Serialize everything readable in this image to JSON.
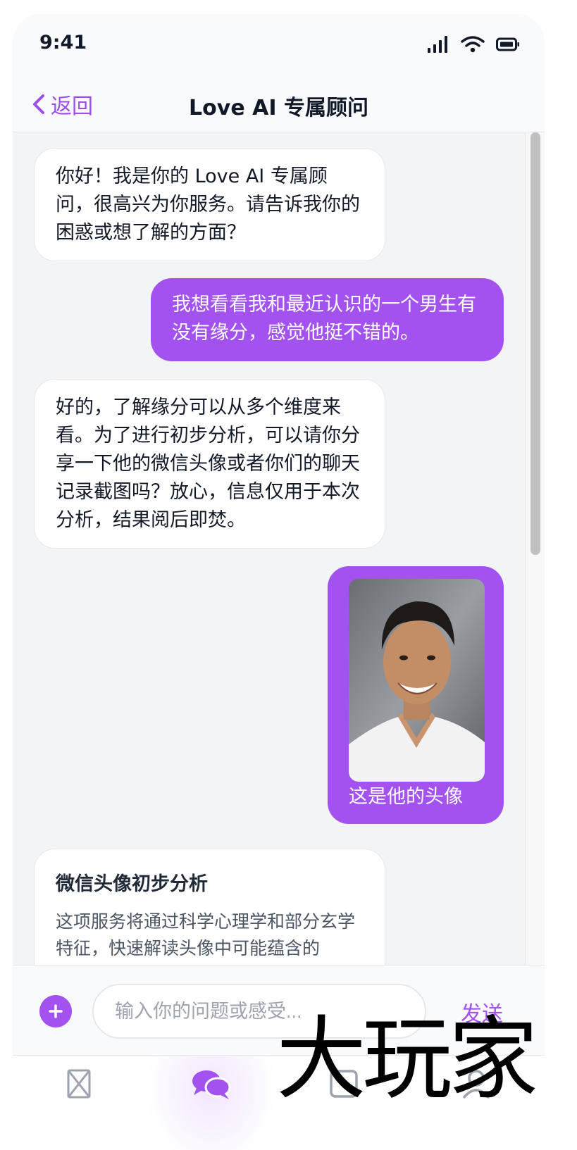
{
  "status_bar": {
    "time": "9:41"
  },
  "header": {
    "back_label": "返回",
    "title": "Love AI 专属顾问"
  },
  "messages": [
    {
      "role": "assistant",
      "text": "你好！我是你的 Love AI 专属顾问，很高兴为你服务。请告诉我你的困惑或想了解的方面？"
    },
    {
      "role": "user",
      "text": "我想看看我和最近认识的一个男生有没有缘分，感觉他挺不错的。"
    },
    {
      "role": "assistant",
      "text": "好的，了解缘分可以从多个维度来看。为了进行初步分析，可以请你分享一下他的微信头像或者你们的聊天记录截图吗？放心，信息仅用于本次分析，结果阅后即焚。"
    },
    {
      "role": "user",
      "caption": "这是他的头像"
    }
  ],
  "analysis_card": {
    "title": "微信头像初步分析",
    "body": "这项服务将通过科学心理学和部分玄学特征，快速解读头像中可能蕴含的"
  },
  "composer": {
    "placeholder": "输入你的问题或感受...",
    "send_label": "发送"
  },
  "watermark": {
    "text": "大玩家"
  },
  "colors": {
    "accent": "#a352ef",
    "background": "#f3f4f6"
  },
  "tabs": [
    {
      "icon": "box-x-icon",
      "active": false
    },
    {
      "icon": "chat-bubbles-icon",
      "active": true
    },
    {
      "icon": "square-icon",
      "active": false
    },
    {
      "icon": "user-icon",
      "active": false
    }
  ]
}
